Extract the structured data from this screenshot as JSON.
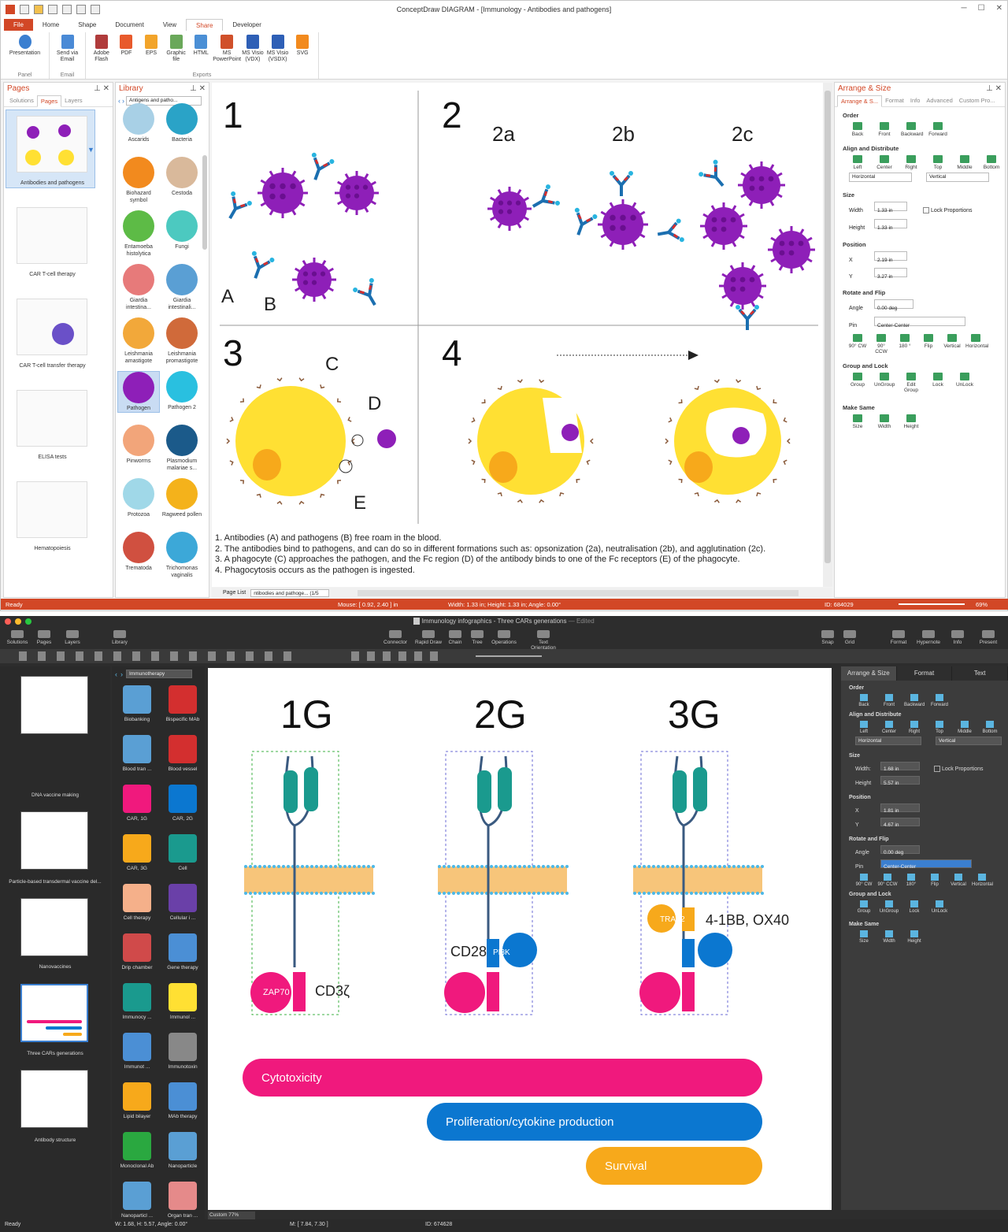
{
  "win1": {
    "title": "ConceptDraw DIAGRAM - [Immunology - Antibodies and pathogens]",
    "tabs": [
      "File",
      "Home",
      "Shape",
      "Document",
      "View",
      "Share",
      "Developer"
    ],
    "ribbon": {
      "panel": {
        "label": "Panel",
        "items": [
          "Presentation"
        ]
      },
      "email": {
        "label": "Email",
        "items": [
          "Send via Email"
        ]
      },
      "exports": {
        "label": "Exports",
        "items": [
          "Adobe Flash",
          "PDF",
          "EPS",
          "Graphic file",
          "HTML",
          "MS PowerPoint",
          "MS Visio (VDX)",
          "MS Visio (VSDX)",
          "SVG"
        ]
      }
    },
    "pages": {
      "title": "Pages",
      "tabs": [
        "Solutions",
        "Pages",
        "Layers"
      ],
      "items": [
        "Antibodies and pathogens",
        "CAR T-cell therapy",
        "CAR T-cell transfer therapy",
        "ELISA tests",
        "Hematopoiesis"
      ]
    },
    "library": {
      "title": "Library",
      "dropdown": "Antigens and patho...",
      "items": [
        "Ascarids",
        "Bacteria",
        "Biohazard symbol",
        "Cestoda",
        "Entamoeba histolytica",
        "Fungi",
        "Giardia intestina...",
        "Giardia intestinali...",
        "Leishmania amastigote",
        "Leishmania promastigote",
        "Pathogen",
        "Pathogen 2",
        "Pinworms",
        "Plasmodium malariae s...",
        "Protozoa",
        "Ragweed pollen",
        "Trematoda",
        "Trichomonas vaginalis"
      ]
    },
    "canvas": {
      "n1": "1",
      "n2": "2",
      "n3": "3",
      "n4": "4",
      "s2a": "2a",
      "s2b": "2b",
      "s2c": "2c",
      "A": "A",
      "B": "B",
      "C": "C",
      "D": "D",
      "E": "E",
      "notes": [
        "1. Antibodies (A) and pathogens (B) free roam in the blood.",
        "2. The antibodies bind to pathogens, and can do so in different formations such as: opsonization (2a), neutralisation (2b), and agglutination (2c).",
        "3. A phagocyte (C) approaches the pathogen, and the Fc region (D) of the antibody binds to one of the Fc receptors (E) of the phagocyte.",
        "4. Phagocytosis occurs as the pathogen is ingested."
      ]
    },
    "pagelist": {
      "label": "Page List",
      "tab": "ntibodies and pathoge... (1/5"
    },
    "arrange": {
      "title": "Arrange & Size",
      "tabs": [
        "Arrange & S...",
        "Format",
        "Info",
        "Advanced",
        "Custom Pro..."
      ],
      "order": {
        "h": "Order",
        "items": [
          "Back",
          "Front",
          "Backward",
          "Forward"
        ]
      },
      "align": {
        "h": "Align and Distribute",
        "items": [
          "Left",
          "Center",
          "Right",
          "Top",
          "Middle",
          "Bottom"
        ],
        "h_sel": "Horizontal",
        "v_sel": "Vertical"
      },
      "size": {
        "h": "Size",
        "width_l": "Width",
        "width": "1.33 in",
        "height_l": "Height",
        "height": "1.33 in",
        "lock": "Lock Proportions"
      },
      "position": {
        "h": "Position",
        "x_l": "X",
        "x": "2.19 in",
        "y_l": "Y",
        "y": "3.27 in"
      },
      "rotate": {
        "h": "Rotate and Flip",
        "angle_l": "Angle",
        "angle": "0.00 deg",
        "pin_l": "Pin",
        "pin": "Center-Center",
        "items": [
          "90° CW",
          "90° CCW",
          "180 °",
          "Flip",
          "Vertical",
          "Horizontal"
        ]
      },
      "group": {
        "h": "Group and Lock",
        "items": [
          "Group",
          "UnGroup",
          "Edit Group",
          "Lock",
          "UnLock"
        ]
      },
      "same": {
        "h": "Make Same",
        "items": [
          "Size",
          "Width",
          "Height"
        ]
      }
    },
    "status": {
      "ready": "Ready",
      "mouse": "Mouse: [ 0.92, 2.40 ] in",
      "dims": "Width: 1.33 in;  Height: 1.33 in;  Angle: 0.00°",
      "id": "ID: 684029",
      "zoom": "69%"
    }
  },
  "win2": {
    "title": "Immunology infographics - Three CARs generations",
    "edited": "— Edited",
    "toolbar": [
      "Solutions",
      "Pages",
      "Layers",
      "Library",
      "Connector",
      "Rapid Draw",
      "Chain",
      "Tree",
      "Operations",
      "Text Orientation",
      "Snap",
      "Grid",
      "Format",
      "Hypernote",
      "Info",
      "Present"
    ],
    "pages": [
      "DNA vaccine making",
      "Particle-based transdermal vaccine del...",
      "Nanovaccines",
      "Three CARs generations",
      "Antibody structure"
    ],
    "library": {
      "dropdown": "Immunotherapy",
      "items": [
        "Biobanking",
        "Bispecific MAb",
        "Blood tran ...",
        "Blood vessel",
        "CAR, 1G",
        "CAR, 2G",
        "CAR, 3G",
        "Cell",
        "Cell therapy",
        "Cellular i ...",
        "Drip chamber",
        "Gene therapy",
        "Immunocy ...",
        "Immunol ...",
        "Immunot ...",
        "Immunotoxin",
        "Lipid bilayer",
        "MAb therapy",
        "Monoclonal Ab",
        "Nanoparticle",
        "Nanoparticl ...",
        "Organ tran ..."
      ]
    },
    "canvas": {
      "g1": "1G",
      "g2": "2G",
      "g3": "3G",
      "zap70": "ZAP70",
      "cd3": "CD3ζ",
      "cd28": "CD28",
      "pi3k": "PI3K",
      "traf2": "TRAF2",
      "bb": "4-1BB, OX40",
      "bars": [
        "Cytotoxicity",
        "Proliferation/cytokine production",
        "Survival"
      ]
    },
    "arrange": {
      "tabs": [
        "Arrange & Size",
        "Format",
        "Text"
      ],
      "order": {
        "h": "Order",
        "items": [
          "Back",
          "Front",
          "Backward",
          "Forward"
        ]
      },
      "align": {
        "h": "Align and Distribute",
        "items": [
          "Left",
          "Center",
          "Right",
          "Top",
          "Middle",
          "Bottom"
        ],
        "h_sel": "Horizontal",
        "v_sel": "Vertical"
      },
      "size": {
        "h": "Size",
        "width_l": "Width:",
        "width": "1.68 in",
        "height_l": "Height",
        "height": "5.57 in",
        "lock": "Lock Proportions"
      },
      "position": {
        "h": "Position",
        "x_l": "X",
        "x": "1.81 in",
        "y_l": "Y",
        "y": "4.67 in"
      },
      "rotate": {
        "h": "Rotate and Flip",
        "angle_l": "Angle",
        "angle": "0.00 deg",
        "pin_l": "Pin",
        "pin": "Center-Center",
        "items": [
          "90° CW",
          "90° CCW",
          "180°",
          "Flip",
          "Vertical",
          "Horizontal"
        ]
      },
      "group": {
        "h": "Group and Lock",
        "items": [
          "Group",
          "UnGroup",
          "Lock",
          "UnLock"
        ]
      },
      "same": {
        "h": "Make Same",
        "items": [
          "Size",
          "Width",
          "Height"
        ]
      }
    },
    "zoom": "Custom 77%",
    "status": {
      "ready": "Ready",
      "dims": "W: 1.68,  H: 5.57,  Angle: 0.00°",
      "mouse": "M: [ 7.84, 7.30 ]",
      "id": "ID: 674628"
    }
  },
  "colors": {
    "accent": "#d24726",
    "purple": "#8e1fb8",
    "yellow": "#ffe033",
    "pink": "#f0197d",
    "blue": "#0b77d0",
    "orange": "#f7a91b",
    "teal": "#1a9a8e"
  }
}
